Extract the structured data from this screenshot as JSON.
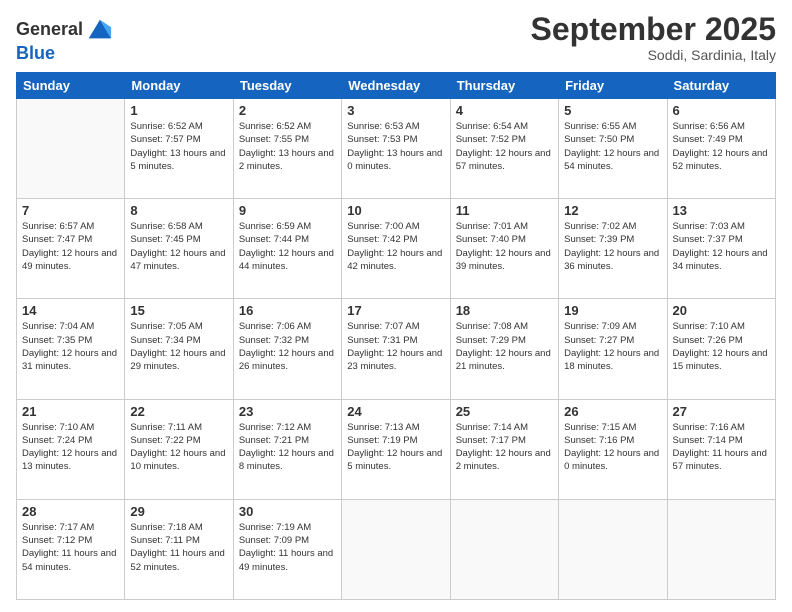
{
  "logo": {
    "line1": "General",
    "line2": "Blue"
  },
  "title": "September 2025",
  "location": "Soddi, Sardinia, Italy",
  "days_of_week": [
    "Sunday",
    "Monday",
    "Tuesday",
    "Wednesday",
    "Thursday",
    "Friday",
    "Saturday"
  ],
  "weeks": [
    [
      {
        "day": "",
        "sunrise": "",
        "sunset": "",
        "daylight": ""
      },
      {
        "day": "1",
        "sunrise": "Sunrise: 6:52 AM",
        "sunset": "Sunset: 7:57 PM",
        "daylight": "Daylight: 13 hours and 5 minutes."
      },
      {
        "day": "2",
        "sunrise": "Sunrise: 6:52 AM",
        "sunset": "Sunset: 7:55 PM",
        "daylight": "Daylight: 13 hours and 2 minutes."
      },
      {
        "day": "3",
        "sunrise": "Sunrise: 6:53 AM",
        "sunset": "Sunset: 7:53 PM",
        "daylight": "Daylight: 13 hours and 0 minutes."
      },
      {
        "day": "4",
        "sunrise": "Sunrise: 6:54 AM",
        "sunset": "Sunset: 7:52 PM",
        "daylight": "Daylight: 12 hours and 57 minutes."
      },
      {
        "day": "5",
        "sunrise": "Sunrise: 6:55 AM",
        "sunset": "Sunset: 7:50 PM",
        "daylight": "Daylight: 12 hours and 54 minutes."
      },
      {
        "day": "6",
        "sunrise": "Sunrise: 6:56 AM",
        "sunset": "Sunset: 7:49 PM",
        "daylight": "Daylight: 12 hours and 52 minutes."
      }
    ],
    [
      {
        "day": "7",
        "sunrise": "Sunrise: 6:57 AM",
        "sunset": "Sunset: 7:47 PM",
        "daylight": "Daylight: 12 hours and 49 minutes."
      },
      {
        "day": "8",
        "sunrise": "Sunrise: 6:58 AM",
        "sunset": "Sunset: 7:45 PM",
        "daylight": "Daylight: 12 hours and 47 minutes."
      },
      {
        "day": "9",
        "sunrise": "Sunrise: 6:59 AM",
        "sunset": "Sunset: 7:44 PM",
        "daylight": "Daylight: 12 hours and 44 minutes."
      },
      {
        "day": "10",
        "sunrise": "Sunrise: 7:00 AM",
        "sunset": "Sunset: 7:42 PM",
        "daylight": "Daylight: 12 hours and 42 minutes."
      },
      {
        "day": "11",
        "sunrise": "Sunrise: 7:01 AM",
        "sunset": "Sunset: 7:40 PM",
        "daylight": "Daylight: 12 hours and 39 minutes."
      },
      {
        "day": "12",
        "sunrise": "Sunrise: 7:02 AM",
        "sunset": "Sunset: 7:39 PM",
        "daylight": "Daylight: 12 hours and 36 minutes."
      },
      {
        "day": "13",
        "sunrise": "Sunrise: 7:03 AM",
        "sunset": "Sunset: 7:37 PM",
        "daylight": "Daylight: 12 hours and 34 minutes."
      }
    ],
    [
      {
        "day": "14",
        "sunrise": "Sunrise: 7:04 AM",
        "sunset": "Sunset: 7:35 PM",
        "daylight": "Daylight: 12 hours and 31 minutes."
      },
      {
        "day": "15",
        "sunrise": "Sunrise: 7:05 AM",
        "sunset": "Sunset: 7:34 PM",
        "daylight": "Daylight: 12 hours and 29 minutes."
      },
      {
        "day": "16",
        "sunrise": "Sunrise: 7:06 AM",
        "sunset": "Sunset: 7:32 PM",
        "daylight": "Daylight: 12 hours and 26 minutes."
      },
      {
        "day": "17",
        "sunrise": "Sunrise: 7:07 AM",
        "sunset": "Sunset: 7:31 PM",
        "daylight": "Daylight: 12 hours and 23 minutes."
      },
      {
        "day": "18",
        "sunrise": "Sunrise: 7:08 AM",
        "sunset": "Sunset: 7:29 PM",
        "daylight": "Daylight: 12 hours and 21 minutes."
      },
      {
        "day": "19",
        "sunrise": "Sunrise: 7:09 AM",
        "sunset": "Sunset: 7:27 PM",
        "daylight": "Daylight: 12 hours and 18 minutes."
      },
      {
        "day": "20",
        "sunrise": "Sunrise: 7:10 AM",
        "sunset": "Sunset: 7:26 PM",
        "daylight": "Daylight: 12 hours and 15 minutes."
      }
    ],
    [
      {
        "day": "21",
        "sunrise": "Sunrise: 7:10 AM",
        "sunset": "Sunset: 7:24 PM",
        "daylight": "Daylight: 12 hours and 13 minutes."
      },
      {
        "day": "22",
        "sunrise": "Sunrise: 7:11 AM",
        "sunset": "Sunset: 7:22 PM",
        "daylight": "Daylight: 12 hours and 10 minutes."
      },
      {
        "day": "23",
        "sunrise": "Sunrise: 7:12 AM",
        "sunset": "Sunset: 7:21 PM",
        "daylight": "Daylight: 12 hours and 8 minutes."
      },
      {
        "day": "24",
        "sunrise": "Sunrise: 7:13 AM",
        "sunset": "Sunset: 7:19 PM",
        "daylight": "Daylight: 12 hours and 5 minutes."
      },
      {
        "day": "25",
        "sunrise": "Sunrise: 7:14 AM",
        "sunset": "Sunset: 7:17 PM",
        "daylight": "Daylight: 12 hours and 2 minutes."
      },
      {
        "day": "26",
        "sunrise": "Sunrise: 7:15 AM",
        "sunset": "Sunset: 7:16 PM",
        "daylight": "Daylight: 12 hours and 0 minutes."
      },
      {
        "day": "27",
        "sunrise": "Sunrise: 7:16 AM",
        "sunset": "Sunset: 7:14 PM",
        "daylight": "Daylight: 11 hours and 57 minutes."
      }
    ],
    [
      {
        "day": "28",
        "sunrise": "Sunrise: 7:17 AM",
        "sunset": "Sunset: 7:12 PM",
        "daylight": "Daylight: 11 hours and 54 minutes."
      },
      {
        "day": "29",
        "sunrise": "Sunrise: 7:18 AM",
        "sunset": "Sunset: 7:11 PM",
        "daylight": "Daylight: 11 hours and 52 minutes."
      },
      {
        "day": "30",
        "sunrise": "Sunrise: 7:19 AM",
        "sunset": "Sunset: 7:09 PM",
        "daylight": "Daylight: 11 hours and 49 minutes."
      },
      {
        "day": "",
        "sunrise": "",
        "sunset": "",
        "daylight": ""
      },
      {
        "day": "",
        "sunrise": "",
        "sunset": "",
        "daylight": ""
      },
      {
        "day": "",
        "sunrise": "",
        "sunset": "",
        "daylight": ""
      },
      {
        "day": "",
        "sunrise": "",
        "sunset": "",
        "daylight": ""
      }
    ]
  ]
}
